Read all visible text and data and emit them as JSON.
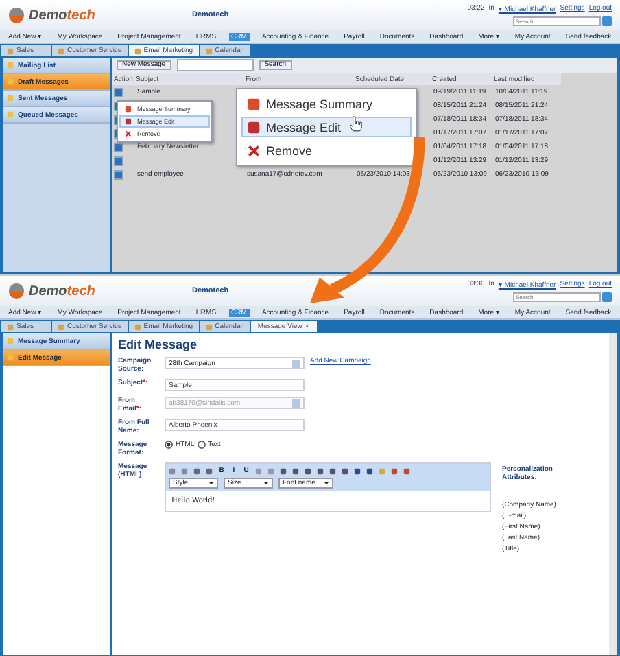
{
  "message_list_screen": {
    "header": {
      "logo_parts": [
        "Demo",
        "tech"
      ],
      "title": "Demotech",
      "clock": "03:22",
      "status": "In",
      "user": "▾ Michael Khaffner",
      "links": [
        "Settings",
        "Log out"
      ],
      "search_placeholder": "Search"
    },
    "nav": [
      {
        "label": "Add New ▾",
        "selected": false
      },
      {
        "label": "My Workspace",
        "selected": false
      },
      {
        "label": "Project Management",
        "selected": false
      },
      {
        "label": "HRMS",
        "selected": false
      },
      {
        "label": "CRM",
        "selected": true
      },
      {
        "label": "Accounting & Finance",
        "selected": false
      },
      {
        "label": "Payroll",
        "selected": false
      },
      {
        "label": "Documents",
        "selected": false
      },
      {
        "label": "Dashboard",
        "selected": false
      },
      {
        "label": "More ▾",
        "selected": false
      },
      {
        "label": "My Account",
        "selected": false
      },
      {
        "label": "Send feedback",
        "selected": false
      }
    ],
    "tabs": [
      {
        "label": "Sales",
        "selected": false
      },
      {
        "label": "Customer Service",
        "selected": false
      },
      {
        "label": "Email Marketing",
        "selected": true
      },
      {
        "label": "Calendar",
        "selected": false
      }
    ],
    "sidebar": [
      {
        "label": "Mailing List",
        "selected": false
      },
      {
        "label": "Draft Messages",
        "selected": true
      },
      {
        "label": "Sent Messages",
        "selected": false
      },
      {
        "label": "Queued Messages",
        "selected": false
      }
    ],
    "toolbar": {
      "new_button": "New Message",
      "search_button": "Search"
    },
    "table": {
      "columns": [
        "Action",
        "Subject",
        "From",
        "Scheduled Date",
        "Created",
        "Last modified"
      ],
      "rows": [
        {
          "subject": "Sample",
          "from": "",
          "scheduled": "",
          "created": "09/19/2011 11:19",
          "last_modified": "10/04/2011 11:19"
        },
        {
          "subject": "",
          "from": "",
          "scheduled": "",
          "created": "08/15/2011 21:24",
          "last_modified": "08/15/2011 21:24"
        },
        {
          "subject": "",
          "from": "",
          "scheduled": "",
          "created": "07/18/2011 18:34",
          "last_modified": "07/18/2011 18:34"
        },
        {
          "subject": "",
          "from": "",
          "scheduled": "",
          "created": "01/17/2011 17:07",
          "last_modified": "01/17/2011 17:07"
        },
        {
          "subject": "February Newsletter",
          "from": "",
          "scheduled": "",
          "created": "01/04/2011 17:18",
          "last_modified": "01/04/2011 17:18"
        },
        {
          "subject": "",
          "from": "",
          "scheduled": "",
          "created": "01/12/2011 13:29",
          "last_modified": "01/12/2011 13:29"
        },
        {
          "subject": "send employee",
          "from": "susana17@cdnetev.com",
          "scheduled": "06/23/2010 14:03",
          "created": "06/23/2010 13:09",
          "last_modified": "06/23/2010 13:09"
        }
      ]
    },
    "context_menu": [
      {
        "label": "Message Summary",
        "selected": false
      },
      {
        "label": "Message Edit",
        "selected": true
      },
      {
        "label": "Remove",
        "selected": false
      }
    ],
    "zoomed_menu": [
      {
        "label": "Message Summary",
        "selected": false
      },
      {
        "label": "Message Edit",
        "selected": true
      },
      {
        "label": "Remove",
        "selected": false
      }
    ]
  },
  "edit_message_screen": {
    "header": {
      "logo_parts": [
        "Demo",
        "tech"
      ],
      "title": "Demotech",
      "clock": "03:30",
      "status": "In",
      "user": "▾ Michael Khaffner",
      "links": [
        "Settings",
        "Log out"
      ],
      "search_placeholder": "Search"
    },
    "nav": [
      {
        "label": "Add New ▾",
        "selected": false
      },
      {
        "label": "My Workspace",
        "selected": false
      },
      {
        "label": "Project Management",
        "selected": false
      },
      {
        "label": "HRMS",
        "selected": false
      },
      {
        "label": "CRM",
        "selected": true
      },
      {
        "label": "Accounting & Finance",
        "selected": false
      },
      {
        "label": "Payroll",
        "selected": false
      },
      {
        "label": "Documents",
        "selected": false
      },
      {
        "label": "Dashboard",
        "selected": false
      },
      {
        "label": "More ▾",
        "selected": false
      },
      {
        "label": "My Account",
        "selected": false
      },
      {
        "label": "Send feedback",
        "selected": false
      }
    ],
    "tabs": [
      {
        "label": "Sales",
        "selected": false
      },
      {
        "label": "Customer Service",
        "selected": false
      },
      {
        "label": "Email Marketing",
        "selected": false
      },
      {
        "label": "Calendar",
        "selected": false
      },
      {
        "label": "Message View",
        "selected": true,
        "close": "×"
      }
    ],
    "sidebar": [
      {
        "label": "Message Summary",
        "selected": false
      },
      {
        "label": "Edit Message",
        "selected": true
      }
    ],
    "heading": "Edit Message",
    "campaign": {
      "label": "Campaign Source:",
      "value": "28th Campaign",
      "link": "Add New Campaign"
    },
    "subject": {
      "label": "Subject",
      "required": "*:",
      "value": "Sample"
    },
    "from_email": {
      "label": "From Email",
      "required": "*:",
      "value": "ab38170@sindalis.com",
      "disabled": true
    },
    "from_name": {
      "label": "From Full Name:",
      "value": "Alberto Phoenix"
    },
    "format": {
      "label": "Message Format:",
      "options": [
        {
          "label": "HTML",
          "selected": true
        },
        {
          "label": "Text",
          "selected": false
        }
      ]
    },
    "message": {
      "label": "Message (HTML):",
      "format_buttons": [
        "B",
        "I",
        "U"
      ],
      "dropdowns": [
        "Style",
        "Size",
        "Font name"
      ],
      "body": "Hello World!"
    },
    "personalization": {
      "title": "Personalization Attributes:",
      "items": [
        "(Company Name)",
        "(E-mail)",
        "(First Name)",
        "(Last Name)",
        "(Title)"
      ]
    }
  }
}
